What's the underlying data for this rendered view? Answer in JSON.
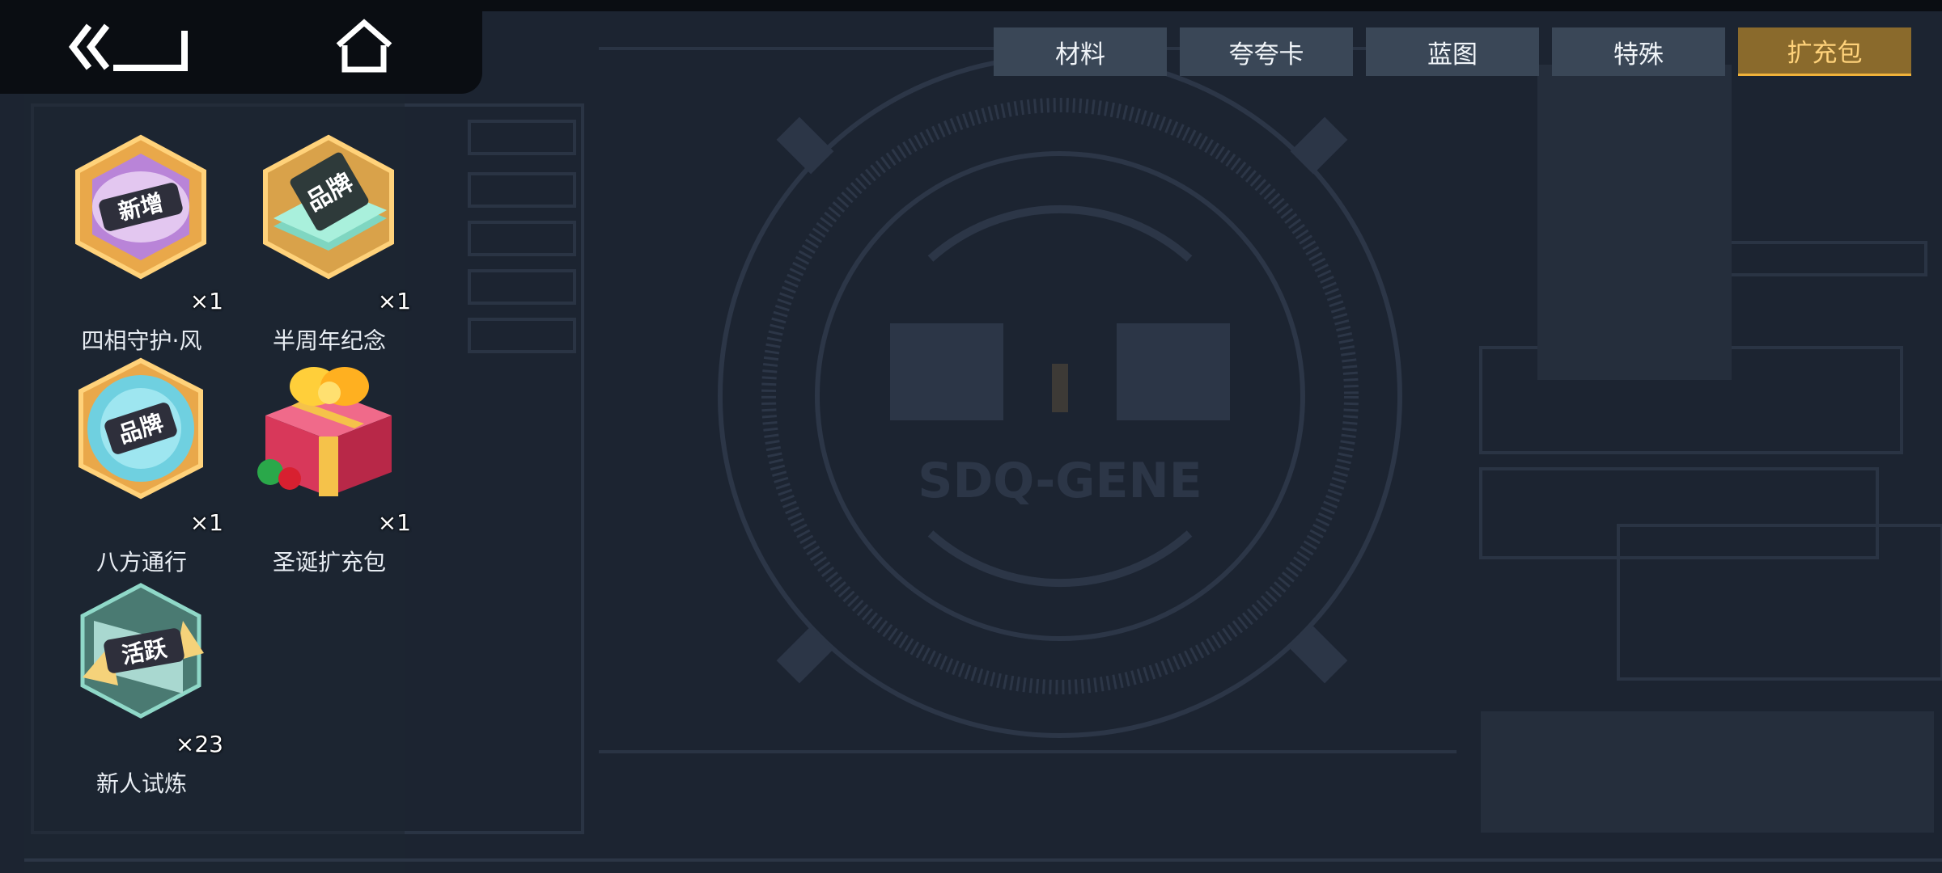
{
  "nav": {
    "back": "back-arrow-icon",
    "home": "home-icon"
  },
  "tabs": [
    {
      "label": "材料",
      "active": false
    },
    {
      "label": "夸夸卡",
      "active": false
    },
    {
      "label": "蓝图",
      "active": false
    },
    {
      "label": "特殊",
      "active": false
    },
    {
      "label": "扩充包",
      "active": true
    }
  ],
  "items": [
    {
      "name": "四相守护·风",
      "count": "×1",
      "icon": "hexagon-badge-xinzeng",
      "badge_text": "新增"
    },
    {
      "name": "半周年纪念",
      "count": "×1",
      "icon": "chip-badge-pinpai",
      "badge_text": "品牌"
    },
    {
      "name": "八方通行",
      "count": "×1",
      "icon": "round-badge-pinpai",
      "badge_text": "品牌"
    },
    {
      "name": "圣诞扩充包",
      "count": "×1",
      "icon": "gift-box-icon",
      "badge_text": ""
    },
    {
      "name": "新人试炼",
      "count": "×23",
      "icon": "hexagon-badge-huoyue",
      "badge_text": "活跃"
    }
  ],
  "background": {
    "logo_text": "SDQ-GENE"
  },
  "colors": {
    "background": "#1c2431",
    "tab": "#3a4757",
    "tab_active": "#8a6a2c",
    "tab_active_text": "#ffd27a"
  }
}
